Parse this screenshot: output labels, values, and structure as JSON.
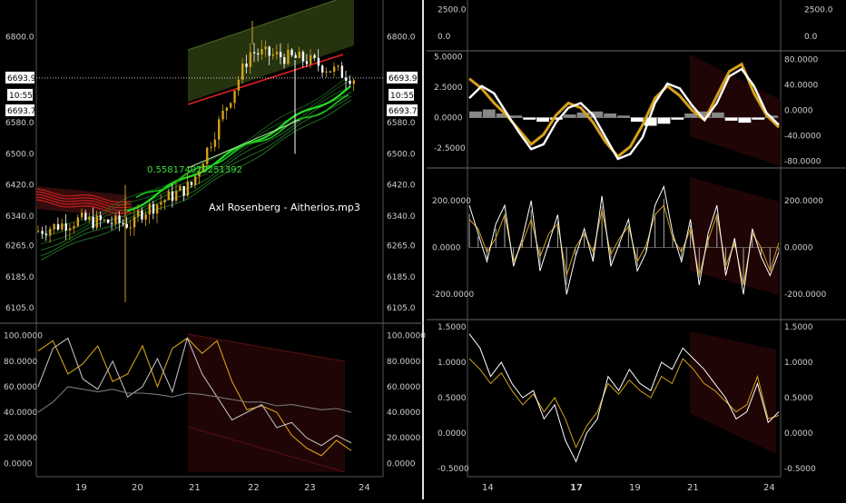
{
  "left": {
    "price_pane": {
      "y_ticks": [
        "6800.0",
        "6580.0",
        "6500.0",
        "6420.0",
        "6340.0",
        "6265.0",
        "6185.0",
        "6105.0"
      ],
      "y_tick_values": [
        6800,
        6580,
        6500,
        6420,
        6340,
        6265,
        6185,
        6105
      ],
      "ylim": [
        6080,
        6875
      ],
      "current_price_label": "6693.9",
      "current_price": 6693.9,
      "time_label": "10:55",
      "sub_price_label": "6693.7",
      "sub_price": 6693.7,
      "annotation": "0.558174029251392",
      "title_overlay": "Axl Rosenberg - Aitherios.mp3",
      "colors": {
        "up": "#d4a019",
        "down": "#ffffff",
        "ribbon_red": "#cc1f1f",
        "ribbon_green": "#22dd22",
        "cloud": "#2b3d10",
        "red_cloud": "#3a0d0d"
      }
    },
    "osc_pane": {
      "y_ticks": [
        "100.0000",
        "80.0000",
        "60.0000",
        "40.0000",
        "20.0000",
        "0.0000"
      ],
      "y_tick_values": [
        100,
        80,
        60,
        40,
        20,
        0
      ],
      "ylim": [
        -4,
        104
      ]
    },
    "x_ticks": [
      "19",
      "20",
      "21",
      "22",
      "23",
      "24"
    ]
  },
  "right": {
    "pane1": {
      "y_ticks": [
        "2500.0",
        "0.0"
      ],
      "y_tick_values": [
        2500,
        0
      ],
      "ylim": [
        -1200,
        3200
      ]
    },
    "pane2": {
      "left_ticks": [
        "5.0000",
        "2.5000",
        "0.0000",
        "-2.5000"
      ],
      "left_tick_values": [
        5,
        2.5,
        0,
        -2.5
      ],
      "right_ticks": [
        "80.0000",
        "40.0000",
        "0.0000",
        "-40.0000",
        "-80.0000"
      ],
      "right_tick_values": [
        80,
        40,
        0,
        -40,
        -80
      ],
      "ylim": [
        -4.0,
        5.2
      ]
    },
    "pane3": {
      "y_ticks": [
        "200.0000",
        "0.0000",
        "-200.0000"
      ],
      "y_tick_values": [
        200,
        0,
        -200
      ],
      "ylim": [
        -300,
        320
      ]
    },
    "pane4": {
      "y_ticks": [
        "1.5000",
        "1.0000",
        "0.5000",
        "0.0000",
        "-0.5000"
      ],
      "y_tick_values": [
        1.5,
        1.0,
        0.5,
        0,
        -0.5
      ],
      "ylim": [
        -0.55,
        1.55
      ]
    },
    "x_ticks": [
      "14",
      "17",
      "19",
      "21",
      "24"
    ]
  },
  "chart_data": [
    {
      "type": "candlestick",
      "pane": "left-price",
      "ylim": [
        6080,
        6875
      ],
      "x_ticks": [
        "19",
        "20",
        "21",
        "22",
        "23",
        "24"
      ],
      "candles_summary": [
        {
          "day": "18",
          "open": 6300,
          "close": 6330,
          "high": 6350,
          "low": 6250
        },
        {
          "day": "19",
          "open": 6330,
          "close": 6320,
          "high": 6360,
          "low": 6240
        },
        {
          "day": "20",
          "open": 6340,
          "close": 6420,
          "high": 6530,
          "low": 6120
        },
        {
          "day": "21",
          "open": 6420,
          "close": 6760,
          "high": 6840,
          "low": 6280
        },
        {
          "day": "22",
          "open": 6760,
          "close": 6740,
          "high": 6820,
          "low": 6500
        },
        {
          "day": "23",
          "open": 6740,
          "close": 6693.9,
          "high": 6790,
          "low": 6660
        }
      ],
      "last_price": 6693.9,
      "annotation": "0.558174029251392"
    },
    {
      "type": "line",
      "pane": "left-oscillator",
      "ylim": [
        0,
        100
      ],
      "series": [
        {
          "name": "",
          "color": "#d4a019",
          "values": [
            88,
            96,
            70,
            78,
            92,
            64,
            70,
            92,
            60,
            90,
            98,
            86,
            96,
            64,
            42,
            45,
            40,
            22,
            12,
            6,
            18,
            10
          ]
        },
        {
          "name": "",
          "color": "#bbbbbb",
          "values": [
            60,
            90,
            98,
            66,
            58,
            80,
            52,
            60,
            82,
            56,
            98,
            70,
            52,
            34,
            40,
            46,
            28,
            32,
            20,
            14,
            22,
            16
          ]
        },
        {
          "name": "",
          "color": "#777777",
          "values": [
            40,
            48,
            60,
            58,
            56,
            58,
            55,
            55,
            54,
            52,
            55,
            54,
            52,
            50,
            48,
            48,
            45,
            46,
            44,
            42,
            43,
            40
          ]
        }
      ]
    },
    {
      "type": "bar",
      "pane": "right-pane2-histogram",
      "ylim": [
        -80,
        80
      ],
      "values": [
        30,
        40,
        20,
        10,
        -10,
        -20,
        -10,
        15,
        25,
        30,
        20,
        10,
        -20,
        -40,
        -30,
        -10,
        20,
        30,
        25,
        -15,
        -25,
        -10,
        10
      ]
    },
    {
      "type": "line",
      "pane": "right-pane2",
      "ylim": [
        -4,
        5.2
      ],
      "series": [
        {
          "name": "",
          "color": "#d4a019",
          "values": [
            3.2,
            2.4,
            1.2,
            0.2,
            -1.0,
            -2.2,
            -1.4,
            0.2,
            1.2,
            0.8,
            -0.4,
            -2.0,
            -3.2,
            -2.4,
            -0.6,
            1.6,
            2.6,
            1.8,
            0.6,
            -0.2,
            1.8,
            3.8,
            4.4,
            2.0,
            0.2,
            -0.8
          ]
        },
        {
          "name": "",
          "color": "#ffffff",
          "values": [
            1.6,
            2.6,
            2.0,
            0.4,
            -1.2,
            -2.6,
            -2.2,
            -0.4,
            0.8,
            1.2,
            0.2,
            -1.6,
            -3.4,
            -3.0,
            -1.6,
            1.2,
            2.8,
            2.4,
            1.0,
            -0.2,
            1.2,
            3.4,
            4.0,
            2.6,
            0.4,
            -0.6
          ]
        }
      ]
    },
    {
      "type": "line",
      "pane": "right-pane3",
      "ylim": [
        -300,
        320
      ],
      "series": [
        {
          "name": "",
          "color": "#d4a019",
          "values": [
            120,
            80,
            -20,
            40,
            140,
            -60,
            20,
            120,
            -40,
            60,
            100,
            -120,
            0,
            60,
            -20,
            160,
            -30,
            40,
            90,
            -60,
            10,
            140,
            180,
            40,
            -20,
            80,
            -120,
            30,
            140,
            -80,
            20,
            -160,
            60,
            0,
            -100,
            20
          ]
        },
        {
          "name": "",
          "color": "#ffffff",
          "values": [
            180,
            60,
            -60,
            100,
            180,
            -80,
            40,
            200,
            -100,
            20,
            140,
            -200,
            -40,
            80,
            -60,
            220,
            -80,
            20,
            120,
            -100,
            -20,
            180,
            260,
            60,
            -60,
            120,
            -160,
            60,
            180,
            -120,
            40,
            -200,
            80,
            -40,
            -120,
            -20
          ]
        }
      ]
    },
    {
      "type": "line",
      "pane": "right-pane4",
      "ylim": [
        -0.55,
        1.55
      ],
      "series": [
        {
          "name": "",
          "color": "#d4a019",
          "values": [
            1.05,
            0.9,
            0.7,
            0.85,
            0.6,
            0.4,
            0.55,
            0.3,
            0.5,
            0.2,
            -0.2,
            0.1,
            0.3,
            0.7,
            0.55,
            0.75,
            0.6,
            0.5,
            0.8,
            0.7,
            1.05,
            0.9,
            0.7,
            0.6,
            0.45,
            0.3,
            0.4,
            0.8,
            0.2,
            0.25
          ]
        },
        {
          "name": "",
          "color": "#ffffff",
          "values": [
            1.4,
            1.2,
            0.8,
            1.0,
            0.7,
            0.5,
            0.6,
            0.2,
            0.4,
            -0.1,
            -0.4,
            0.0,
            0.2,
            0.8,
            0.6,
            0.9,
            0.7,
            0.6,
            1.0,
            0.9,
            1.2,
            1.05,
            0.9,
            0.7,
            0.5,
            0.2,
            0.3,
            0.7,
            0.15,
            0.3
          ]
        }
      ]
    }
  ]
}
